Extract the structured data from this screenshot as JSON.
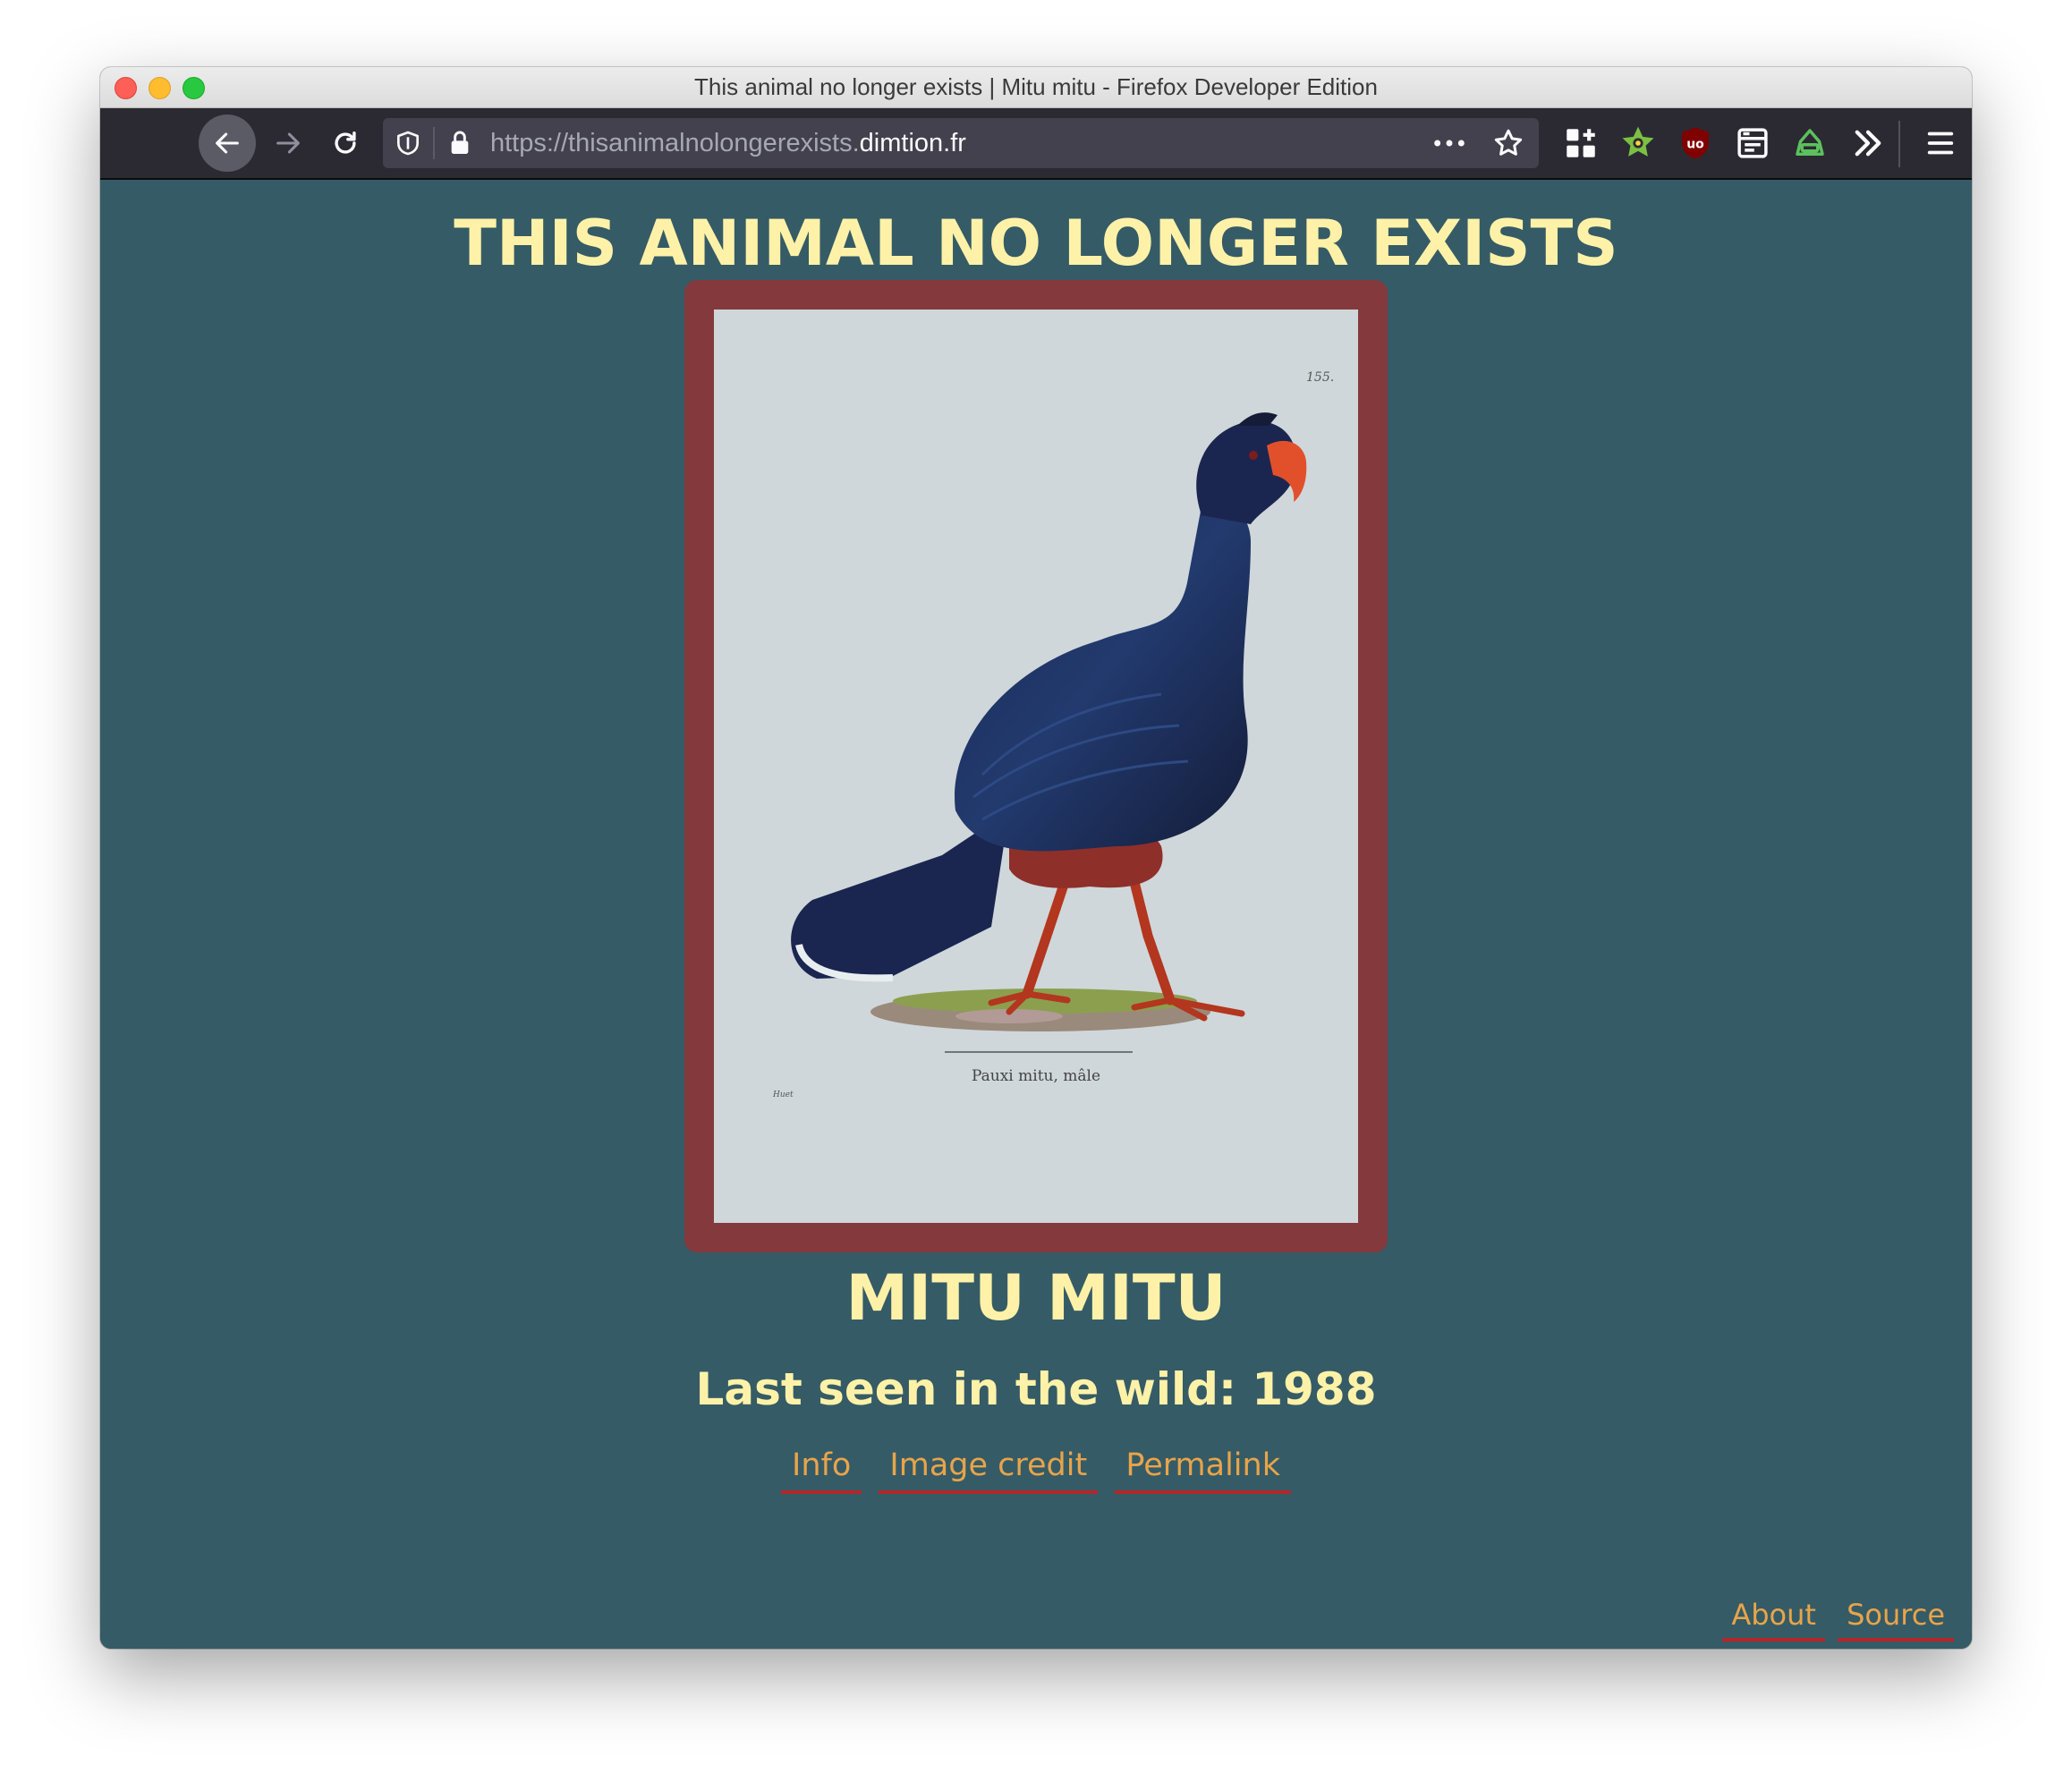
{
  "window": {
    "title": "This animal no longer exists | Mitu mitu - Firefox Developer Edition"
  },
  "toolbar": {
    "url_prefix": "https://thisanimalnolongerexists.",
    "url_domain": "dimtion.fr",
    "buttons": [
      "back-icon",
      "forward-icon",
      "reload-icon",
      "shield-icon",
      "lock-icon",
      "more-icon",
      "star-icon"
    ],
    "extensions": [
      "extensions-grid-icon",
      "green-star-extension-icon",
      "ublock-origin-icon",
      "reader-extension-icon",
      "hat-extension-icon",
      "overflow-chevrons-icon",
      "hamburger-menu-icon"
    ]
  },
  "page": {
    "title": "THIS ANIMAL NO LONGER EXISTS",
    "species": "MITU MITU",
    "last_seen": "Last seen in the wild: 1988",
    "plate_number": "155.",
    "plate_caption": "Pauxi mitu, mâle",
    "plate_signature": "Huet",
    "links": {
      "info": "Info",
      "image_credit": "Image credit",
      "permalink": "Permalink"
    },
    "footer": {
      "about": "About",
      "source": "Source"
    }
  },
  "colors": {
    "page_bg": "#355b66",
    "text_yellow": "#fff2a8",
    "link_orange": "#e8a44a",
    "link_underline": "#b4262a",
    "frame": "#843a3d"
  }
}
